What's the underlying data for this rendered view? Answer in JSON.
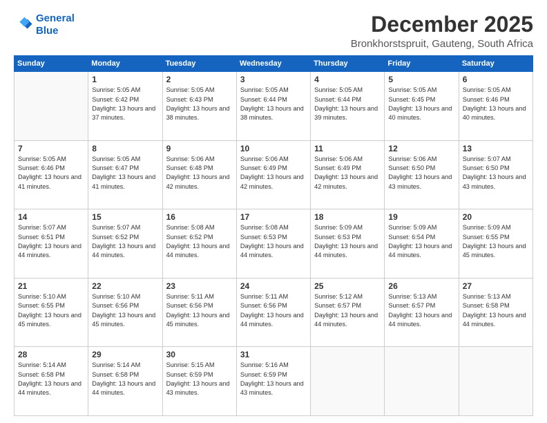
{
  "logo": {
    "line1": "General",
    "line2": "Blue"
  },
  "title": "December 2025",
  "subtitle": "Bronkhorstspruit, Gauteng, South Africa",
  "header": {
    "days": [
      "Sunday",
      "Monday",
      "Tuesday",
      "Wednesday",
      "Thursday",
      "Friday",
      "Saturday"
    ]
  },
  "weeks": [
    [
      {
        "day": "",
        "info": ""
      },
      {
        "day": "1",
        "info": "Sunrise: 5:05 AM\nSunset: 6:42 PM\nDaylight: 13 hours\nand 37 minutes."
      },
      {
        "day": "2",
        "info": "Sunrise: 5:05 AM\nSunset: 6:43 PM\nDaylight: 13 hours\nand 38 minutes."
      },
      {
        "day": "3",
        "info": "Sunrise: 5:05 AM\nSunset: 6:44 PM\nDaylight: 13 hours\nand 38 minutes."
      },
      {
        "day": "4",
        "info": "Sunrise: 5:05 AM\nSunset: 6:44 PM\nDaylight: 13 hours\nand 39 minutes."
      },
      {
        "day": "5",
        "info": "Sunrise: 5:05 AM\nSunset: 6:45 PM\nDaylight: 13 hours\nand 40 minutes."
      },
      {
        "day": "6",
        "info": "Sunrise: 5:05 AM\nSunset: 6:46 PM\nDaylight: 13 hours\nand 40 minutes."
      }
    ],
    [
      {
        "day": "7",
        "info": "Sunrise: 5:05 AM\nSunset: 6:46 PM\nDaylight: 13 hours\nand 41 minutes."
      },
      {
        "day": "8",
        "info": "Sunrise: 5:05 AM\nSunset: 6:47 PM\nDaylight: 13 hours\nand 41 minutes."
      },
      {
        "day": "9",
        "info": "Sunrise: 5:06 AM\nSunset: 6:48 PM\nDaylight: 13 hours\nand 42 minutes."
      },
      {
        "day": "10",
        "info": "Sunrise: 5:06 AM\nSunset: 6:49 PM\nDaylight: 13 hours\nand 42 minutes."
      },
      {
        "day": "11",
        "info": "Sunrise: 5:06 AM\nSunset: 6:49 PM\nDaylight: 13 hours\nand 42 minutes."
      },
      {
        "day": "12",
        "info": "Sunrise: 5:06 AM\nSunset: 6:50 PM\nDaylight: 13 hours\nand 43 minutes."
      },
      {
        "day": "13",
        "info": "Sunrise: 5:07 AM\nSunset: 6:50 PM\nDaylight: 13 hours\nand 43 minutes."
      }
    ],
    [
      {
        "day": "14",
        "info": "Sunrise: 5:07 AM\nSunset: 6:51 PM\nDaylight: 13 hours\nand 44 minutes."
      },
      {
        "day": "15",
        "info": "Sunrise: 5:07 AM\nSunset: 6:52 PM\nDaylight: 13 hours\nand 44 minutes."
      },
      {
        "day": "16",
        "info": "Sunrise: 5:08 AM\nSunset: 6:52 PM\nDaylight: 13 hours\nand 44 minutes."
      },
      {
        "day": "17",
        "info": "Sunrise: 5:08 AM\nSunset: 6:53 PM\nDaylight: 13 hours\nand 44 minutes."
      },
      {
        "day": "18",
        "info": "Sunrise: 5:09 AM\nSunset: 6:53 PM\nDaylight: 13 hours\nand 44 minutes."
      },
      {
        "day": "19",
        "info": "Sunrise: 5:09 AM\nSunset: 6:54 PM\nDaylight: 13 hours\nand 44 minutes."
      },
      {
        "day": "20",
        "info": "Sunrise: 5:09 AM\nSunset: 6:55 PM\nDaylight: 13 hours\nand 45 minutes."
      }
    ],
    [
      {
        "day": "21",
        "info": "Sunrise: 5:10 AM\nSunset: 6:55 PM\nDaylight: 13 hours\nand 45 minutes."
      },
      {
        "day": "22",
        "info": "Sunrise: 5:10 AM\nSunset: 6:56 PM\nDaylight: 13 hours\nand 45 minutes."
      },
      {
        "day": "23",
        "info": "Sunrise: 5:11 AM\nSunset: 6:56 PM\nDaylight: 13 hours\nand 45 minutes."
      },
      {
        "day": "24",
        "info": "Sunrise: 5:11 AM\nSunset: 6:56 PM\nDaylight: 13 hours\nand 44 minutes."
      },
      {
        "day": "25",
        "info": "Sunrise: 5:12 AM\nSunset: 6:57 PM\nDaylight: 13 hours\nand 44 minutes."
      },
      {
        "day": "26",
        "info": "Sunrise: 5:13 AM\nSunset: 6:57 PM\nDaylight: 13 hours\nand 44 minutes."
      },
      {
        "day": "27",
        "info": "Sunrise: 5:13 AM\nSunset: 6:58 PM\nDaylight: 13 hours\nand 44 minutes."
      }
    ],
    [
      {
        "day": "28",
        "info": "Sunrise: 5:14 AM\nSunset: 6:58 PM\nDaylight: 13 hours\nand 44 minutes."
      },
      {
        "day": "29",
        "info": "Sunrise: 5:14 AM\nSunset: 6:58 PM\nDaylight: 13 hours\nand 44 minutes."
      },
      {
        "day": "30",
        "info": "Sunrise: 5:15 AM\nSunset: 6:59 PM\nDaylight: 13 hours\nand 43 minutes."
      },
      {
        "day": "31",
        "info": "Sunrise: 5:16 AM\nSunset: 6:59 PM\nDaylight: 13 hours\nand 43 minutes."
      },
      {
        "day": "",
        "info": ""
      },
      {
        "day": "",
        "info": ""
      },
      {
        "day": "",
        "info": ""
      }
    ]
  ]
}
